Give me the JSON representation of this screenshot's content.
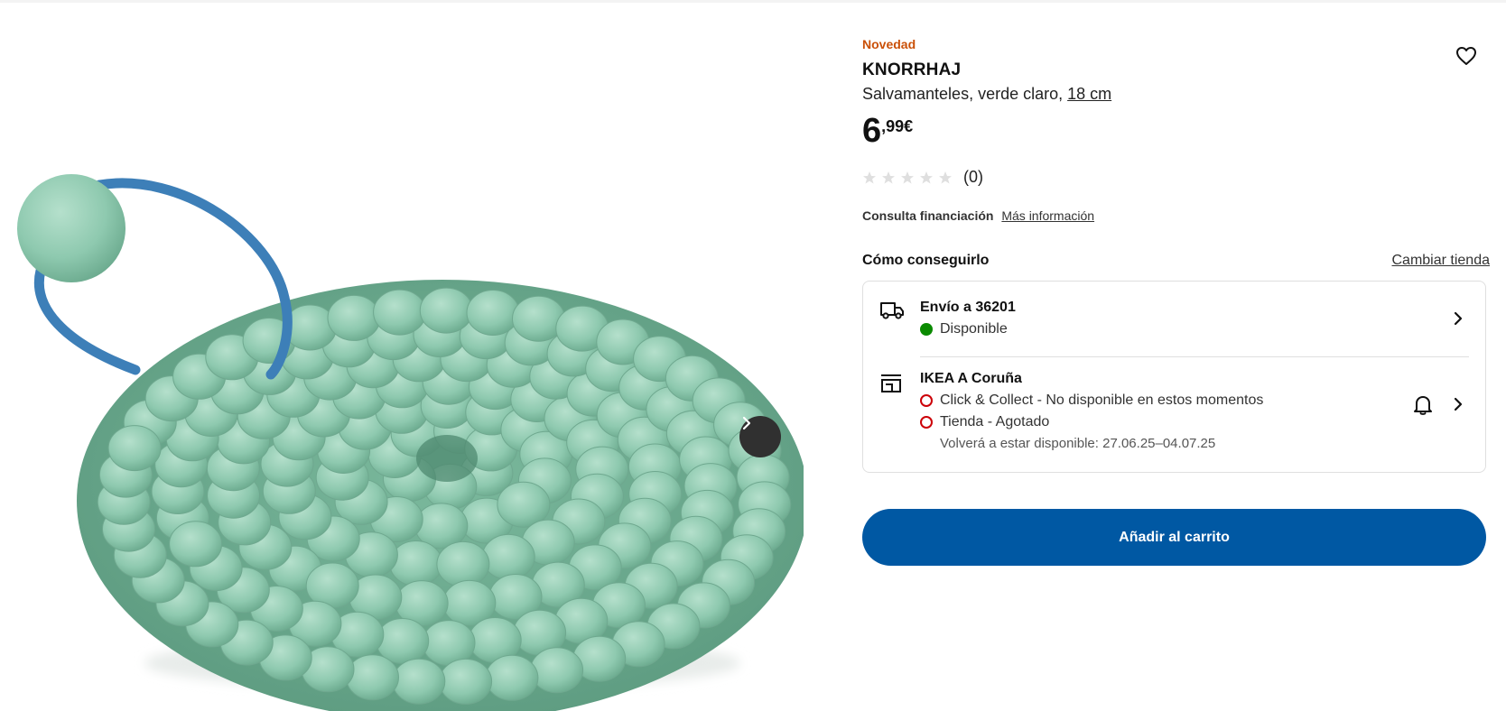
{
  "product": {
    "badge": "Novedad",
    "name": "KNORRHAJ",
    "description": "Salvamanteles, verde claro,",
    "size_link": "18 cm",
    "price_integer": "6",
    "price_decimal": ",99€",
    "rating_count": "(0)",
    "rating_value": 0,
    "rating_max": 5
  },
  "finance": {
    "label": "Consulta financiación",
    "link": "Más información"
  },
  "availability": {
    "heading": "Cómo conseguirlo",
    "change_store": "Cambiar tienda",
    "delivery": {
      "title": "Envío a 36201",
      "status": "Disponible"
    },
    "store": {
      "title": "IKEA A Coruña",
      "click_collect": "Click & Collect - No disponible en estos momentos",
      "in_store": "Tienda - Agotado",
      "restock": "Volverá a estar disponible: 27.06.25–04.07.25"
    }
  },
  "actions": {
    "add_to_cart": "Añadir al carrito"
  },
  "icons": {
    "favorite": "heart-icon",
    "next": "chevron-right-icon",
    "delivery": "truck-icon",
    "store": "store-icon",
    "notify": "bell-icon",
    "rating": "star-icon"
  },
  "colors": {
    "badge": "#ca5008",
    "primary_button": "#0058a3",
    "available": "#0a8a00",
    "unavailable": "#cc0008",
    "product": "#8ec9af",
    "strap": "#3d7fb8"
  }
}
